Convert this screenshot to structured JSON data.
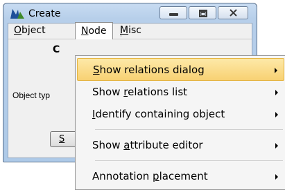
{
  "window": {
    "title": "Create",
    "colors": {
      "accent_highlight": "#f8d173",
      "titlebar": "#b7cfea"
    }
  },
  "titlebar_buttons": {
    "minimize_icon": "minimize-icon",
    "maximize_icon": "maximize-icon",
    "close_icon": "close-icon"
  },
  "menubar": {
    "object": {
      "first": "O",
      "rest": "bject"
    },
    "node": {
      "first": "N",
      "rest": "ode"
    },
    "misc": {
      "first": "M",
      "rest": "isc"
    }
  },
  "body": {
    "heading_fragment": "C",
    "object_type_label": "Object typ",
    "button_fragment": "S"
  },
  "node_menu": {
    "items": [
      {
        "pre": "",
        "ul": "S",
        "post": "how relations dialog",
        "highlighted": true
      },
      {
        "pre": "Show ",
        "ul": "r",
        "post": "elations list",
        "highlighted": false
      },
      {
        "pre": "",
        "ul": "I",
        "post": "dentify containing object",
        "highlighted": false
      },
      {
        "pre": "Show ",
        "ul": "a",
        "post": "ttribute editor",
        "highlighted": false
      },
      {
        "pre": "Annotation ",
        "ul": "p",
        "post": "lacement",
        "highlighted": false
      }
    ]
  }
}
